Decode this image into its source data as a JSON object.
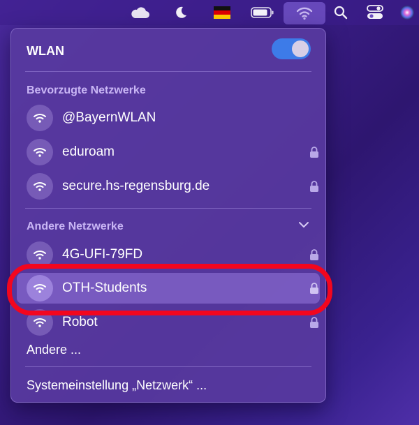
{
  "menubar": {
    "icons": [
      "cloud-icon",
      "moon-icon",
      "german-flag-icon",
      "battery-icon",
      "wifi-icon",
      "search-icon",
      "control-center-icon",
      "siri-icon"
    ]
  },
  "panel": {
    "title": "WLAN",
    "wifi_enabled": true,
    "preferred_title": "Bevorzugte Netzwerke",
    "preferred": [
      {
        "name": "@BayernWLAN",
        "locked": false
      },
      {
        "name": "eduroam",
        "locked": true
      },
      {
        "name": "secure.hs-regensburg.de",
        "locked": true
      }
    ],
    "other_title": "Andere Netzwerke",
    "other": [
      {
        "name": "4G-UFI-79FD",
        "locked": true
      },
      {
        "name": "OTH-Students",
        "locked": true,
        "highlighted": true
      },
      {
        "name": "Robot",
        "locked": true
      }
    ],
    "other_more": "Andere ...",
    "settings_link": "Systemeinstellung „Netzwerk“ ..."
  },
  "colors": {
    "accent_toggle": "#3d7be8",
    "section_title": "#c9b6f5",
    "annotation_outline": "#f3061e"
  }
}
